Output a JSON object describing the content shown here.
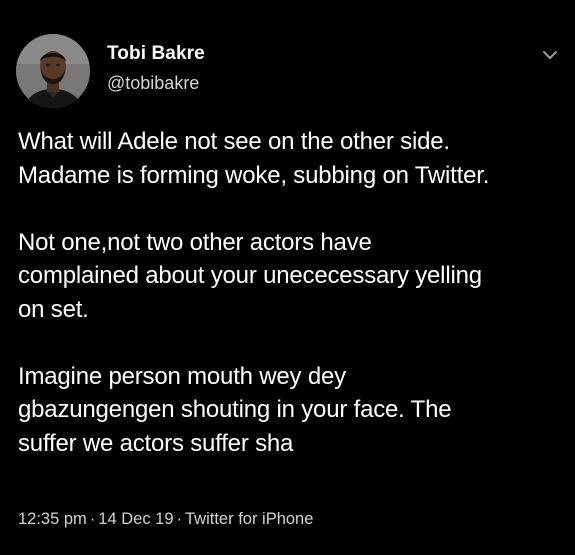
{
  "author": {
    "display_name": "Tobi Bakre",
    "handle": "@tobibakre"
  },
  "tweet": {
    "lines": {
      "p1_l1": "What will Adele not see on the other side.",
      "p1_l2": "Madame is forming woke, subbing on Twitter.",
      "p2_l1": "Not one,not two other actors have",
      "p2_l2": "complained about your unececessary yelling",
      "p2_l3": "on set.",
      "p3_l1": "Imagine person mouth wey dey",
      "p3_l2": "gbazungengen shouting in your face. The",
      "p3_l3": "suffer we actors suffer sha"
    }
  },
  "meta": {
    "time": "12:35 pm",
    "separator": "·",
    "date": "14 Dec 19",
    "source": "Twitter for iPhone"
  },
  "icons": {
    "menu": "chevron-down-icon",
    "avatar": "profile-photo"
  },
  "colors": {
    "background": "#000000",
    "text": "#ffffff",
    "secondary_text": "#d3d3d3"
  }
}
